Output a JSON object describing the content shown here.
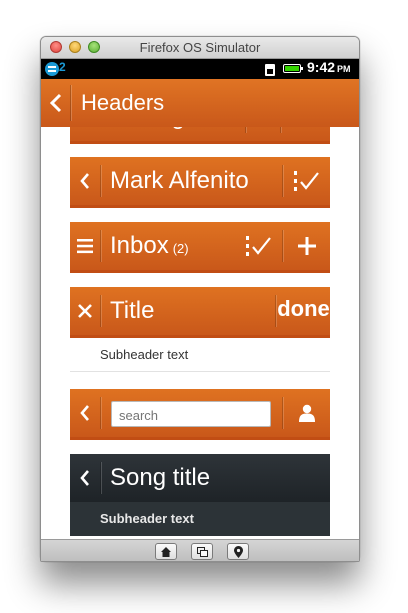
{
  "window": {
    "title": "Firefox OS Simulator"
  },
  "statusbar": {
    "left_label": "2",
    "time": "9:42",
    "ampm": "PM"
  },
  "header": {
    "back_icon": "chevron-left-icon",
    "title": "Headers"
  },
  "examples": {
    "partial_title": "Settings",
    "mark": {
      "title": "Mark Alfenito"
    },
    "inbox": {
      "title": "Inbox",
      "count": "(2)"
    },
    "titlebar": {
      "title": "Title",
      "done": "done",
      "subheader": "Subheader text"
    },
    "search": {
      "placeholder": "search"
    },
    "song": {
      "title": "Song title",
      "subheader": "Subheader text"
    }
  },
  "colors": {
    "accent": "#d86a21",
    "dark": "#272d31"
  }
}
